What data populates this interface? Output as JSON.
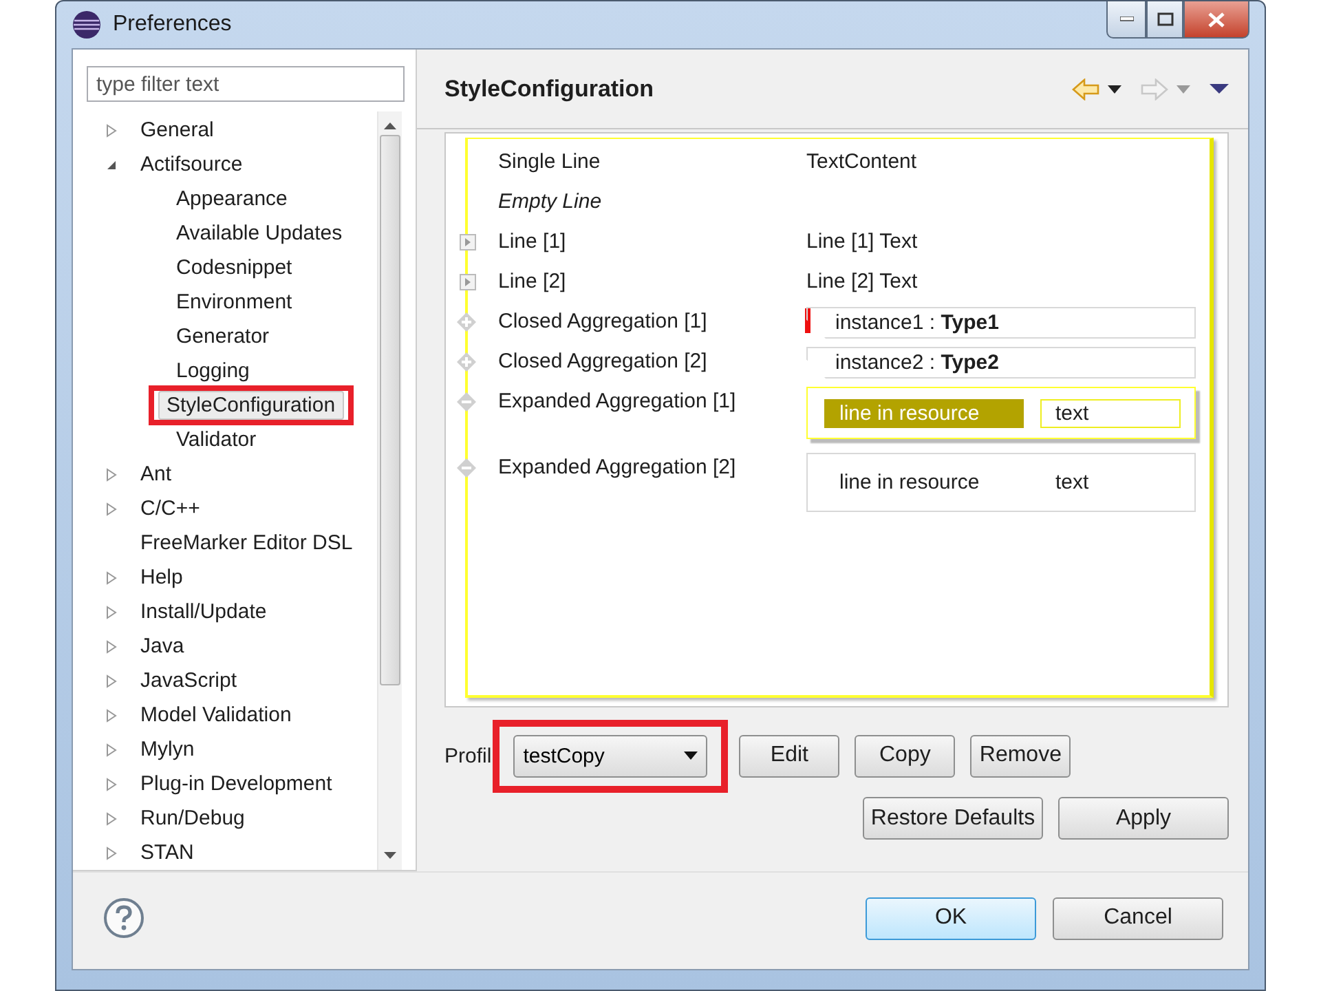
{
  "window": {
    "title": "Preferences"
  },
  "filter": {
    "placeholder": "type filter text"
  },
  "tree": [
    {
      "label": "General",
      "kind": "folder",
      "expanded": false,
      "selected": false
    },
    {
      "label": "Actifsource",
      "kind": "folder",
      "expanded": true,
      "selected": false,
      "children": [
        {
          "label": "Appearance",
          "selected": false
        },
        {
          "label": "Available Updates",
          "selected": false
        },
        {
          "label": "Codesnippet",
          "selected": false
        },
        {
          "label": "Environment",
          "selected": false
        },
        {
          "label": "Generator",
          "selected": false
        },
        {
          "label": "Logging",
          "selected": false
        },
        {
          "label": "StyleConfiguration",
          "selected": true,
          "highlighted": true
        },
        {
          "label": "Validator",
          "selected": false
        }
      ]
    },
    {
      "label": "Ant",
      "kind": "folder",
      "expanded": false,
      "selected": false
    },
    {
      "label": "C/C++",
      "kind": "folder",
      "expanded": false,
      "selected": false
    },
    {
      "label": "FreeMarker Editor DSL",
      "kind": "leaf",
      "selected": false
    },
    {
      "label": "Help",
      "kind": "folder",
      "expanded": false,
      "selected": false
    },
    {
      "label": "Install/Update",
      "kind": "folder",
      "expanded": false,
      "selected": false
    },
    {
      "label": "Java",
      "kind": "folder",
      "expanded": false,
      "selected": false
    },
    {
      "label": "JavaScript",
      "kind": "folder",
      "expanded": false,
      "selected": false
    },
    {
      "label": "Model Validation",
      "kind": "folder",
      "expanded": false,
      "selected": false
    },
    {
      "label": "Mylyn",
      "kind": "folder",
      "expanded": false,
      "selected": false
    },
    {
      "label": "Plug-in Development",
      "kind": "folder",
      "expanded": false,
      "selected": false
    },
    {
      "label": "Run/Debug",
      "kind": "folder",
      "expanded": false,
      "selected": false
    },
    {
      "label": "STAN",
      "kind": "folder",
      "expanded": false,
      "selected": false
    }
  ],
  "page": {
    "title": "StyleConfiguration"
  },
  "editor": [
    {
      "kind": "text",
      "label": "Single Line",
      "value": "TextContent"
    },
    {
      "kind": "empty",
      "label": "Empty Line"
    },
    {
      "kind": "line",
      "label": "Line [1]",
      "value": "Line [1] Text"
    },
    {
      "kind": "line",
      "label": "Line [2]",
      "value": "Line [2] Text"
    },
    {
      "kind": "closed",
      "label": "Closed Aggregation [1]",
      "instance": "instance1  :  **Type1**",
      "error": true
    },
    {
      "kind": "closed",
      "label": "Closed Aggregation [2]",
      "instance": "instance2  :  **Type2**",
      "error": false
    },
    {
      "kind": "expanded",
      "label": "Expanded Aggregation [1]",
      "cells": [
        "line in resource",
        "text"
      ],
      "selected": true
    },
    {
      "kind": "expanded",
      "label": "Expanded Aggregation [2]",
      "cells": [
        "line in resource",
        "text"
      ],
      "selected": false
    }
  ],
  "profile": {
    "label": "Profil",
    "value": "testCopy",
    "highlighted": true,
    "buttons": [
      "Edit",
      "Copy",
      "Remove"
    ]
  },
  "page_buttons": [
    "Restore Defaults",
    "Apply"
  ],
  "dialog_buttons": [
    {
      "label": "OK",
      "default": true
    },
    {
      "label": "Cancel",
      "default": false
    }
  ]
}
